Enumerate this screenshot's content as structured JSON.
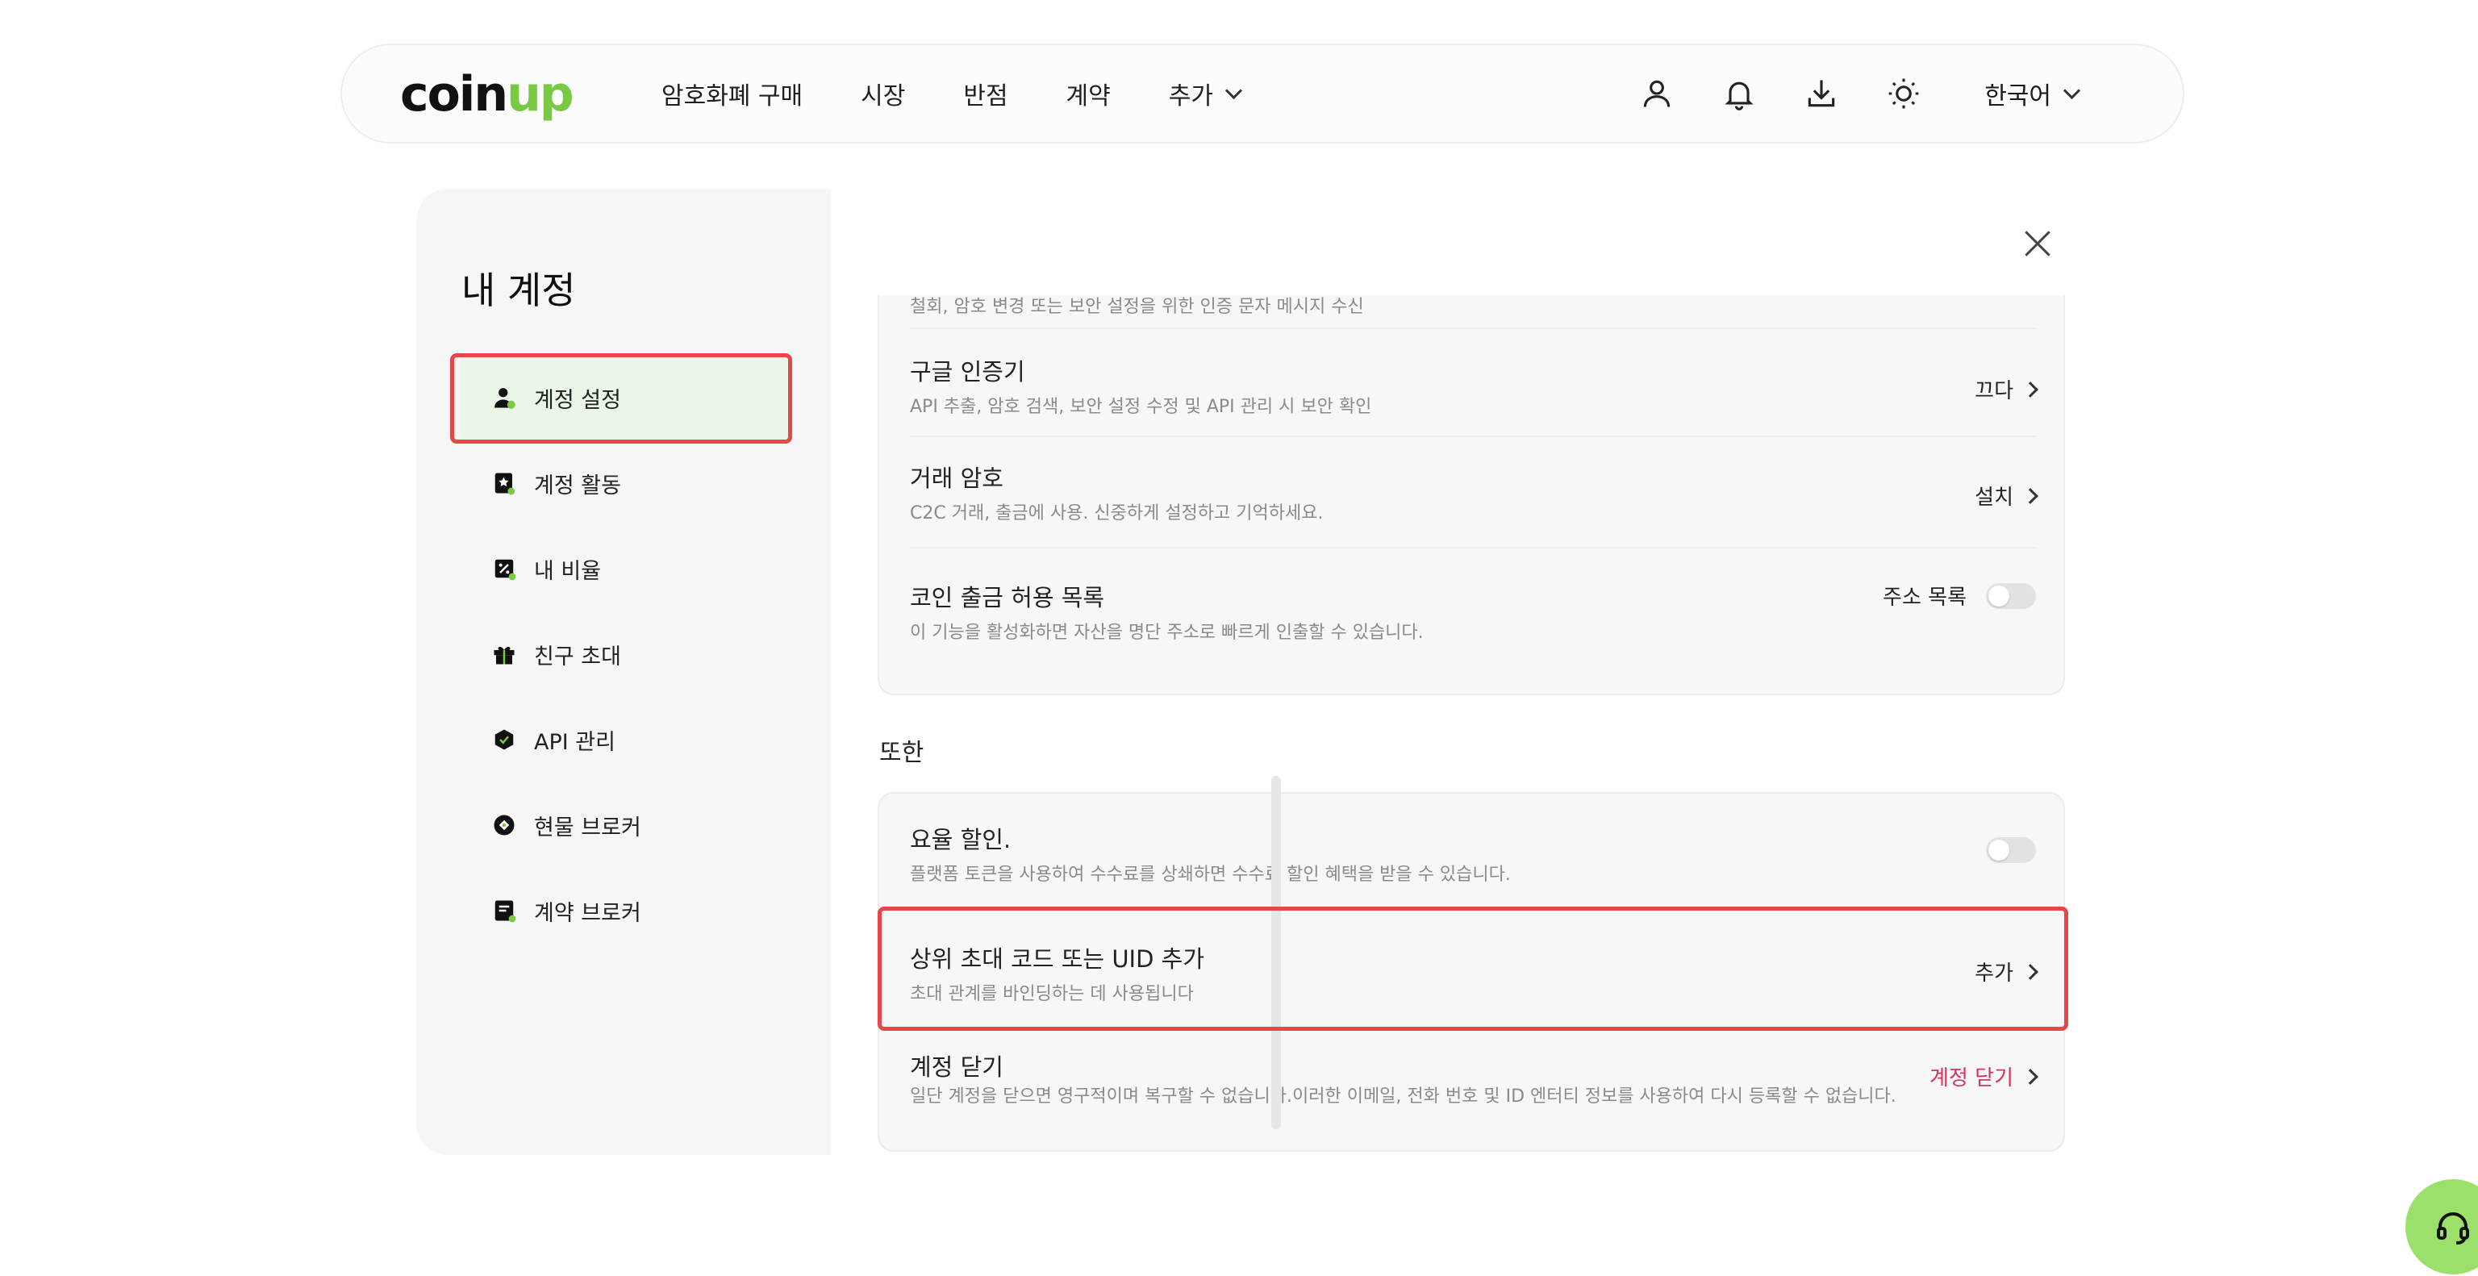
{
  "nav": {
    "logo_main": "coin",
    "logo_accent": "up",
    "links": [
      "암호화폐 구매",
      "시장",
      "반점",
      "계약",
      "추가"
    ],
    "language": "한국어",
    "icons": [
      "user-icon",
      "bell-icon",
      "download-icon",
      "sun-icon"
    ]
  },
  "sidebar": {
    "title": "내 계정",
    "items": [
      {
        "label": "계정 설정",
        "icon": "user-settings-icon",
        "active": true
      },
      {
        "label": "계정 활동",
        "icon": "bookmark-star-icon"
      },
      {
        "label": "내 비율",
        "icon": "percent-icon"
      },
      {
        "label": "친구 초대",
        "icon": "gift-icon"
      },
      {
        "label": "API 관리",
        "icon": "api-shield-icon"
      },
      {
        "label": "현물 브로커",
        "icon": "spot-broker-icon"
      },
      {
        "label": "계약 브로커",
        "icon": "contract-broker-icon"
      }
    ]
  },
  "security": {
    "partial_desc": "철회, 암호 변경 또는 보안 설정을 위한 인증 문자 메시지 수신",
    "rows": [
      {
        "title": "구글 인증기",
        "desc": "API 추출, 암호 검색, 보안 설정 수정 및 API 관리 시 보안 확인",
        "action": "끄다"
      },
      {
        "title": "거래 암호",
        "desc": "C2C 거래, 출금에 사용. 신중하게 설정하고 기억하세요.",
        "action": "설치"
      },
      {
        "title": "코인 출금 허용 목록",
        "desc": "이 기능을 활성화하면 자산을 명단 주소로 빠르게 인출할 수 있습니다.",
        "action": "주소 목록",
        "toggle": false
      }
    ]
  },
  "also": {
    "label": "또한",
    "rows": [
      {
        "title": "요율 할인.",
        "desc": "플랫폼 토큰을 사용하여 수수료를 상쇄하면 수수료 할인 혜택을 받을 수 있습니다.",
        "toggle": false
      },
      {
        "title": "상위 초대 코드 또는 UID 추가",
        "desc": "초대 관계를 바인딩하는 데 사용됩니다",
        "action": "추가"
      },
      {
        "title": "계정 닫기",
        "desc": "일단 계정을 닫으면 영구적이며 복구할 수 없습니다.이러한 이메일, 전화 번호 및 ID 엔터티 정보를 사용하여 다시 등록할 수 없습니다.",
        "action": "계정 닫기",
        "action_color": "#d9325b"
      }
    ]
  },
  "colors": {
    "brand": "#7ac943",
    "highlight": "#e54848",
    "danger": "#d9325b",
    "support": "#9be06a"
  }
}
